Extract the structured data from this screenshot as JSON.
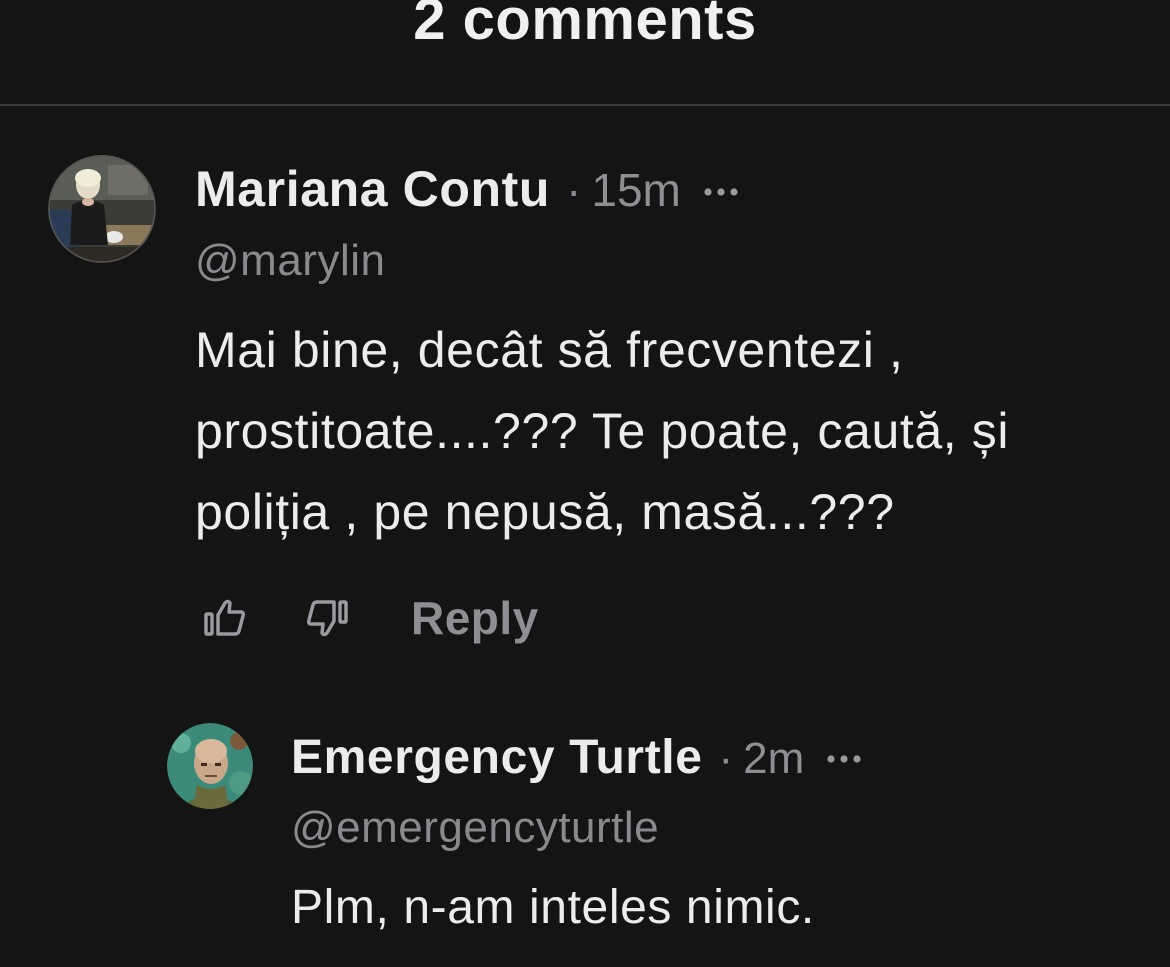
{
  "header": {
    "title": "2 comments"
  },
  "comments": [
    {
      "author": "Mariana Contu",
      "separator": "·",
      "time": "15m",
      "handle": "@marylin",
      "text": "Mai bine, decât să frecventezi , prostitoate....??? Te poate, caută, și poliția , pe nepusă, masă...???",
      "avatar_icon": "profile-photo",
      "actions": {
        "like_icon": "thumbs-up-icon",
        "dislike_icon": "thumbs-down-icon",
        "reply_label": "Reply"
      }
    },
    {
      "author": "Emergency Turtle",
      "separator": "·",
      "time": "2m",
      "handle": "@emergencyturtle",
      "text": "Plm, n-am inteles nimic.",
      "avatar_icon": "profile-illustration"
    }
  ],
  "colors": {
    "background": "#141414",
    "text": "#ececec",
    "muted": "#8e8e93",
    "divider": "#3a3a3c"
  }
}
